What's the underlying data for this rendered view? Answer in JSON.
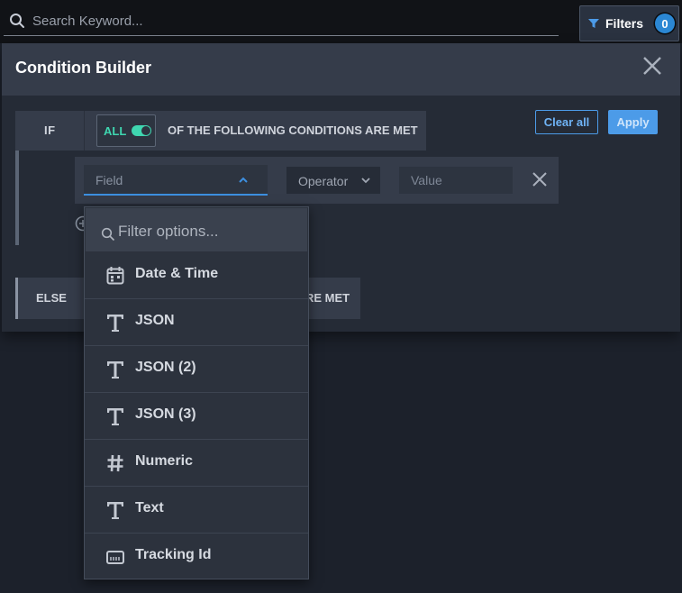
{
  "search": {
    "placeholder": "Search Keyword..."
  },
  "filters": {
    "label": "Filters",
    "count": "0"
  },
  "builder": {
    "title": "Condition Builder",
    "if_label": "IF",
    "all_label": "ALL",
    "conditions_text": "OF THE FOLLOWING CONDITIONS ARE MET",
    "clear_label": "Clear all",
    "apply_label": "Apply",
    "field_placeholder": "Field",
    "operator_placeholder": "Operator",
    "value_placeholder": "Value",
    "else_label": "ELSE",
    "else_conditions_text": "RE MET"
  },
  "dropdown": {
    "search_placeholder": "Filter options...",
    "items": [
      {
        "label": "Date & Time",
        "icon": "calendar-icon"
      },
      {
        "label": "JSON",
        "icon": "text-type-icon"
      },
      {
        "label": "JSON (2)",
        "icon": "text-type-icon"
      },
      {
        "label": "JSON (3)",
        "icon": "text-type-icon"
      },
      {
        "label": "Numeric",
        "icon": "hash-icon"
      },
      {
        "label": "Text",
        "icon": "text-type-icon"
      },
      {
        "label": "Tracking Id",
        "icon": "barcode-icon"
      }
    ]
  },
  "colors": {
    "accent": "#4c9be8",
    "toggle": "#3fd6b0",
    "badge": "#2b87d3"
  }
}
